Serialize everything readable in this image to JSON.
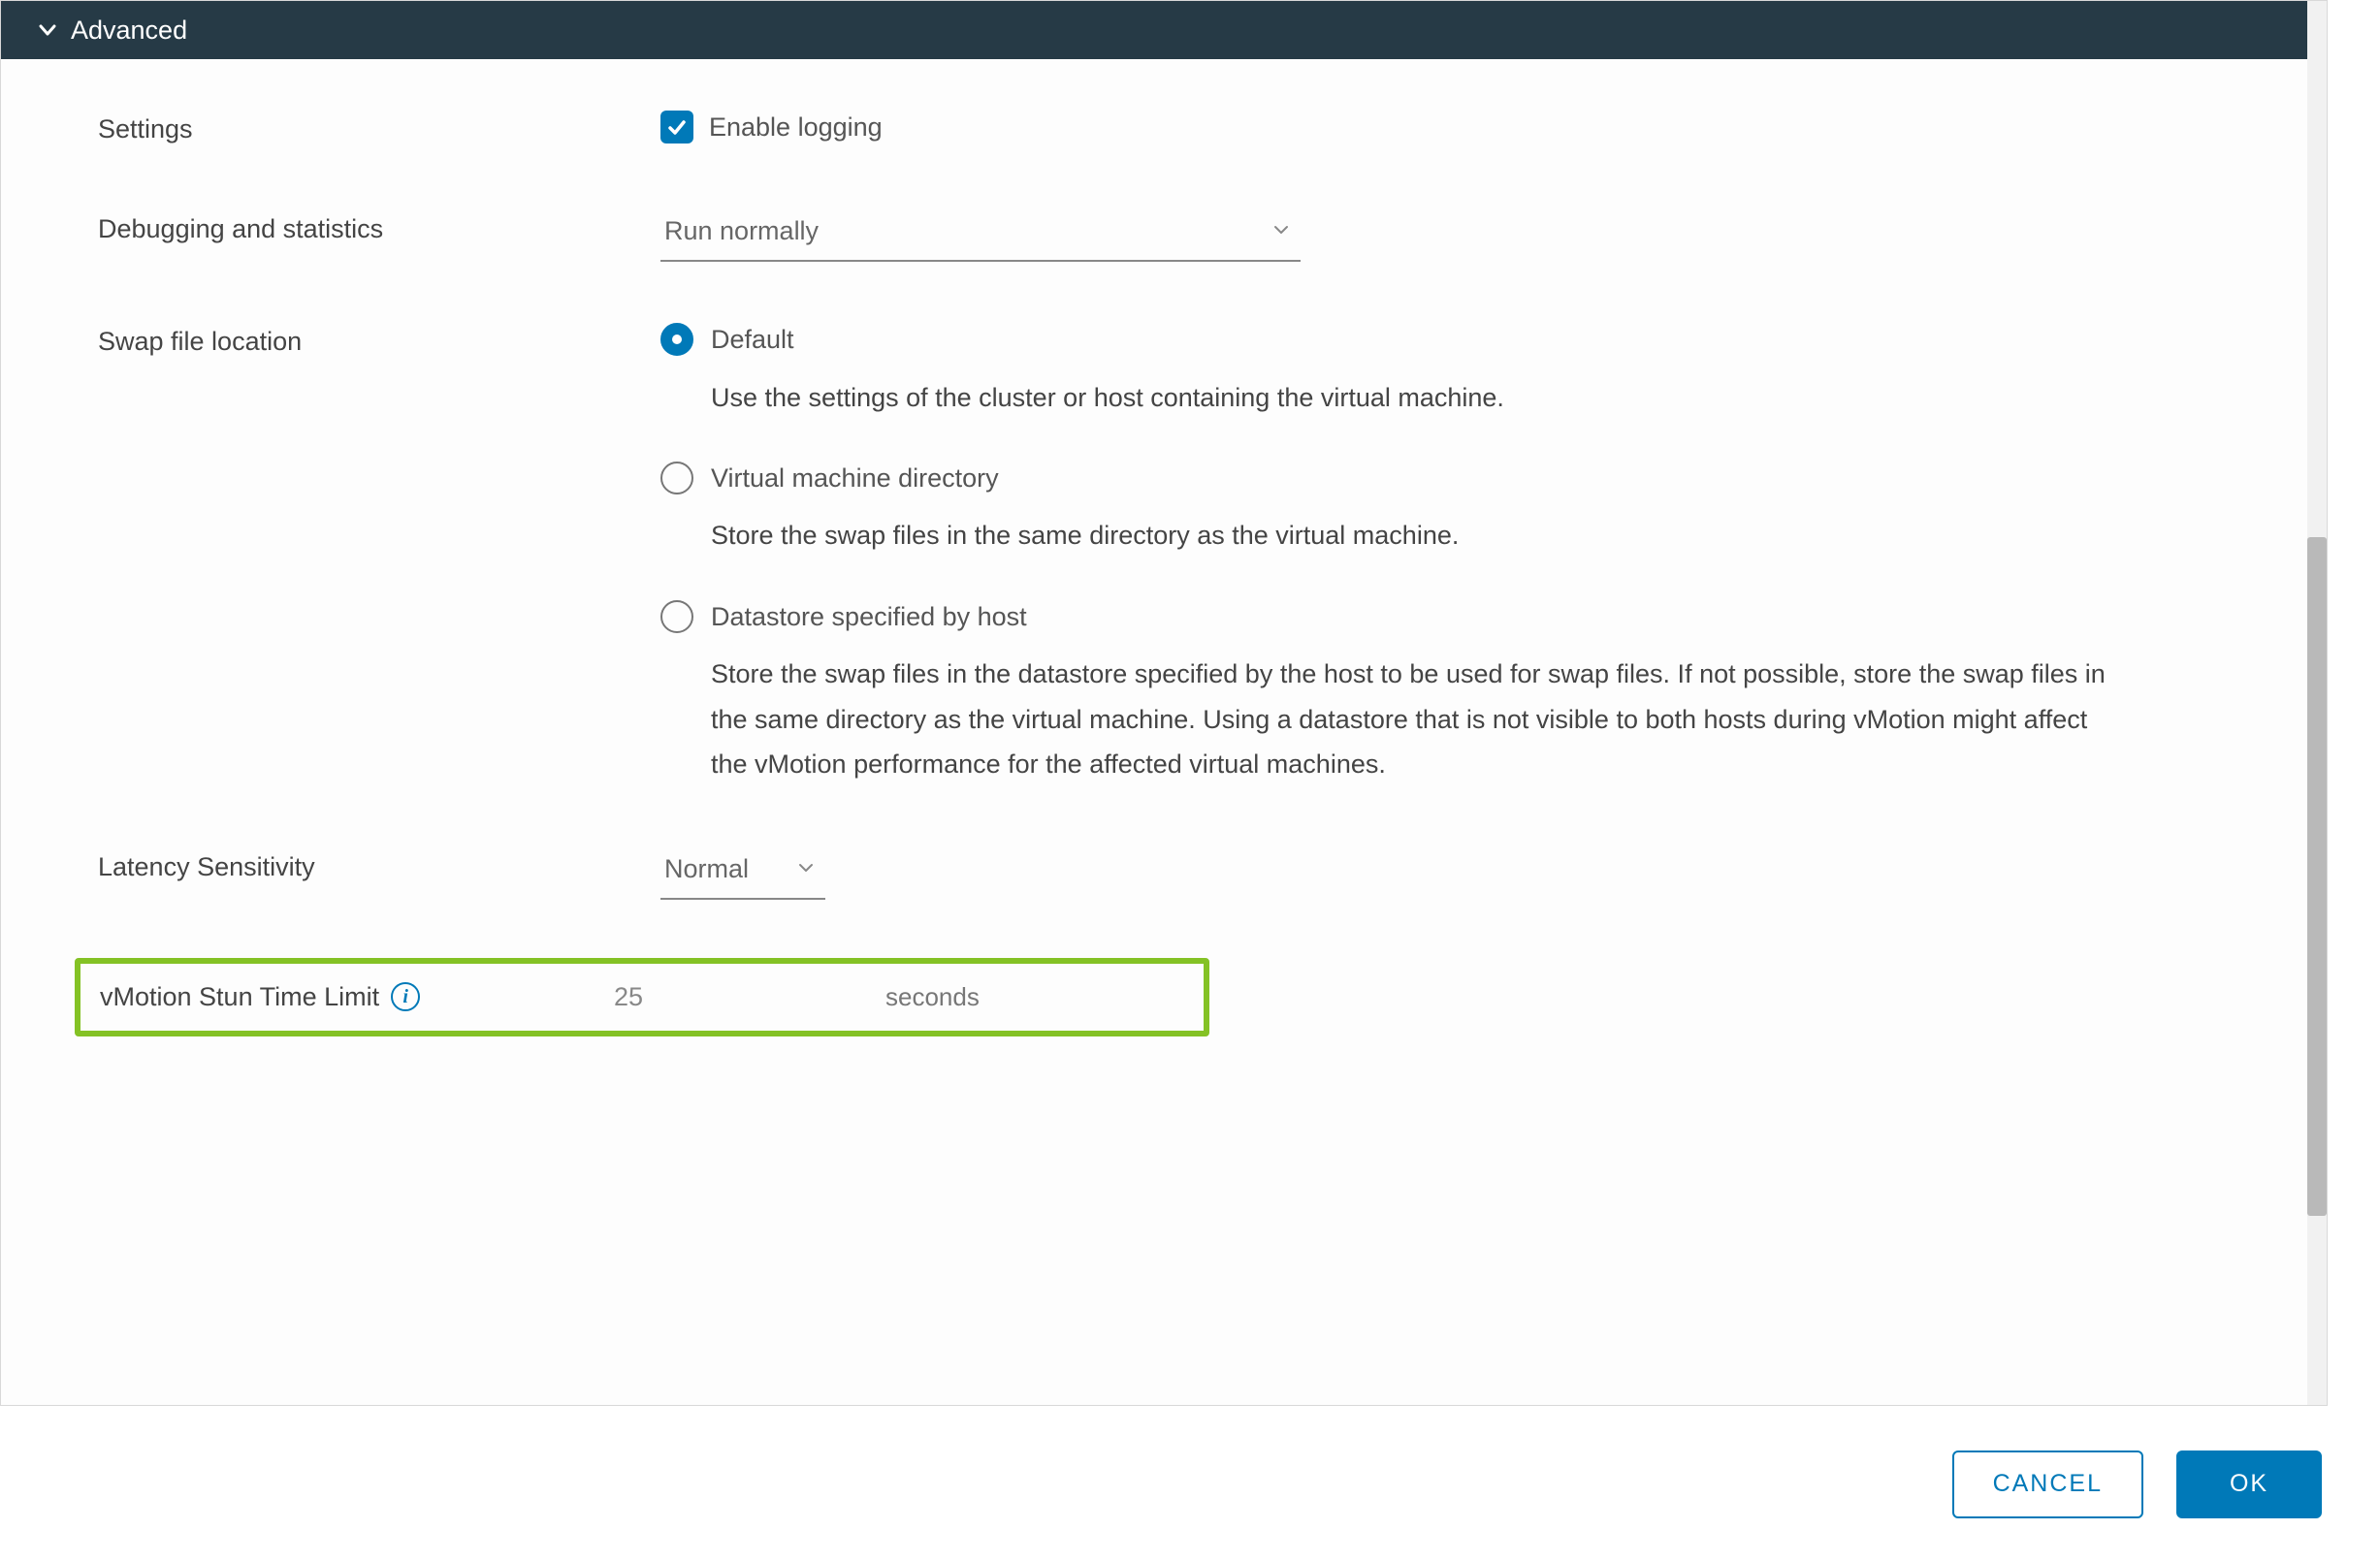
{
  "section": {
    "title": "Advanced"
  },
  "settings": {
    "label": "Settings",
    "checkbox_label": "Enable logging"
  },
  "debugging": {
    "label": "Debugging and statistics",
    "selected": "Run normally"
  },
  "swap": {
    "label": "Swap file location",
    "options": [
      {
        "label": "Default",
        "desc": "Use the settings of the cluster or host containing the virtual machine."
      },
      {
        "label": "Virtual machine directory",
        "desc": "Store the swap files in the same directory as the virtual machine."
      },
      {
        "label": "Datastore specified by host",
        "desc": "Store the swap files in the datastore specified by the host to be used for swap files. If not possible, store the swap files in the same directory as the virtual machine. Using a datastore that is not visible to both hosts during vMotion might affect the vMotion performance for the affected virtual machines."
      }
    ]
  },
  "latency": {
    "label": "Latency Sensitivity",
    "selected": "Normal"
  },
  "stun": {
    "label": "vMotion Stun Time Limit",
    "value": "25",
    "unit": "seconds"
  },
  "footer": {
    "cancel": "CANCEL",
    "ok": "OK"
  }
}
